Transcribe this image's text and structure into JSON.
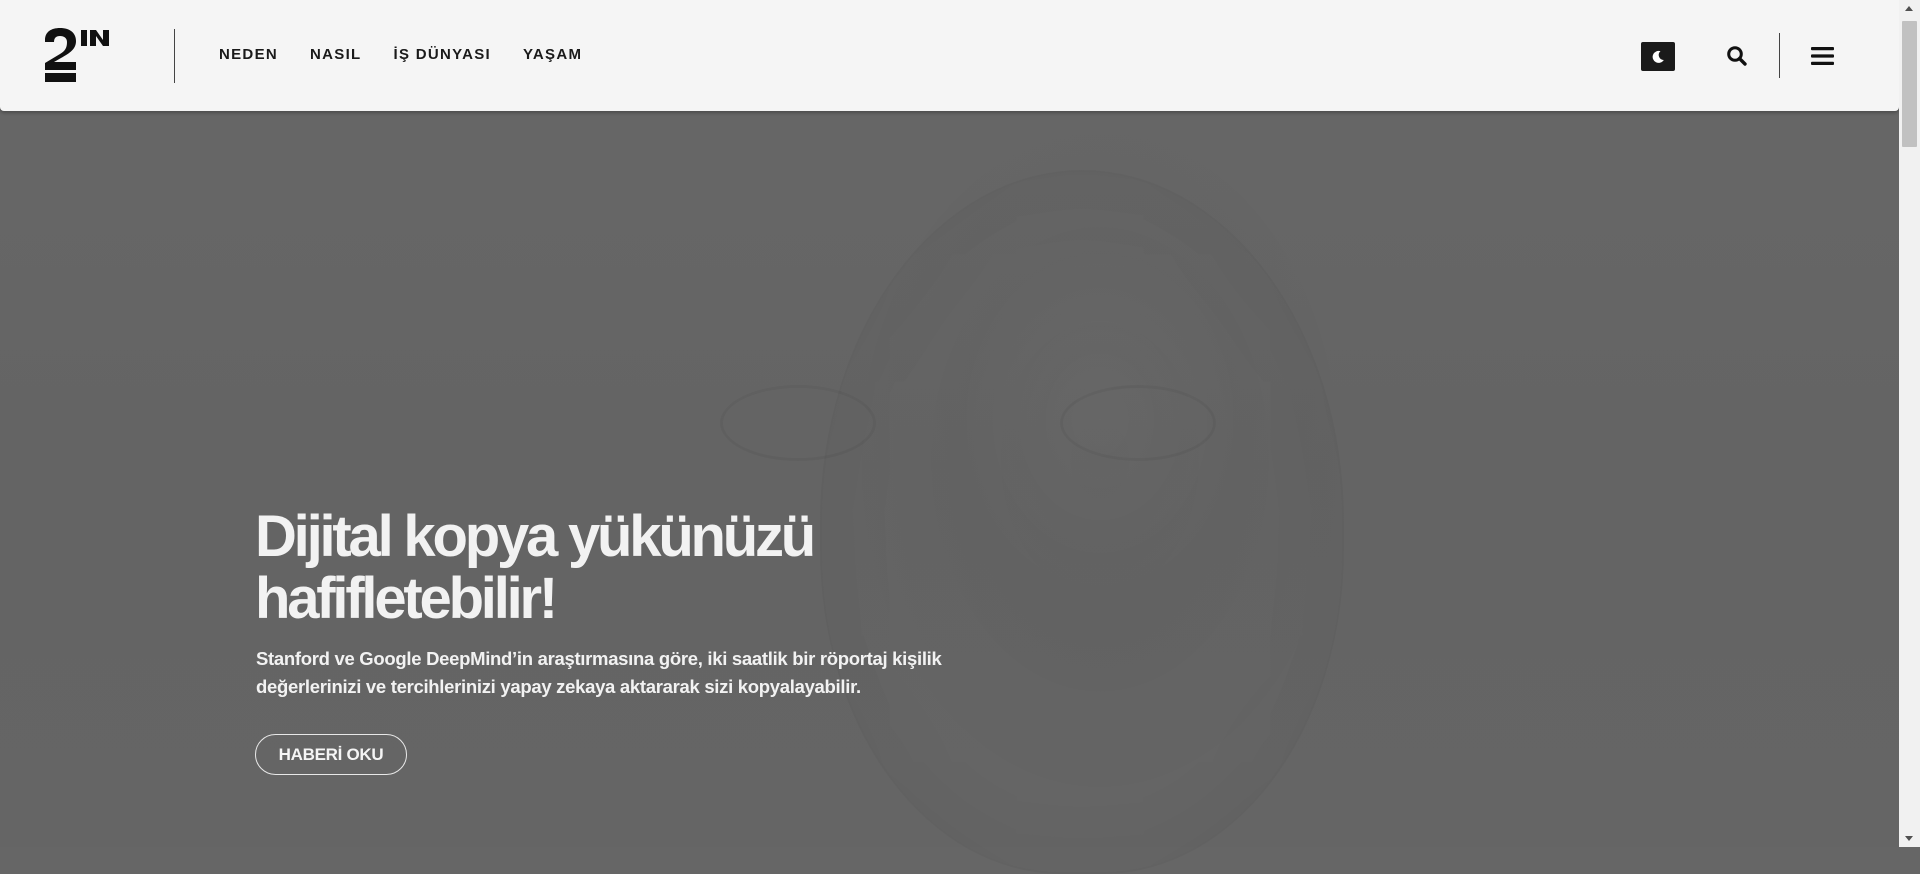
{
  "header": {
    "logo": {
      "alt": "2N",
      "icon": "logo-mark"
    },
    "nav": [
      {
        "label": "NEDEN"
      },
      {
        "label": "NASIL"
      },
      {
        "label": "İŞ DÜNYASI"
      },
      {
        "label": "YAŞAM"
      }
    ],
    "actions": {
      "dark_mode_icon": "moon-icon",
      "search_icon": "search-icon",
      "menu_icon": "hamburger-icon"
    }
  },
  "hero": {
    "headline": "Dijital kopya yükünüzü hafifletebilir!",
    "subtitle": "Stanford ve Google DeepMind’in araştırmasına göre, iki saatlik bir röportaj kişilik değerlerinizi ve tercihlerinizi yapay zekaya aktararak sizi kopyalayabilir.",
    "cta_label": "HABERİ OKU"
  },
  "colors": {
    "header_bg": "#f5f5f5",
    "hero_overlay": "#666666",
    "text_light": "#f2f2f2",
    "text_dark": "#1a1a1a"
  }
}
